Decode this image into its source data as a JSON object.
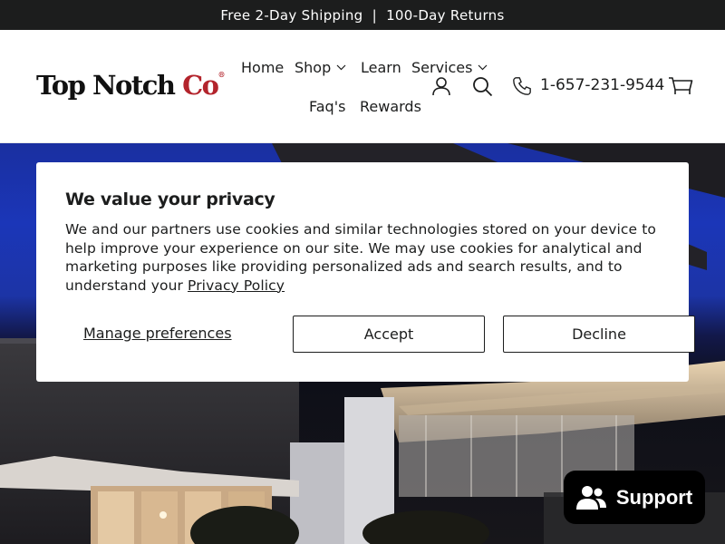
{
  "announcement": {
    "text": "Free 2-Day Shipping  |  100-Day Returns"
  },
  "header": {
    "logo": {
      "text": "Top Notch ",
      "accent": "Co",
      "reg": "®"
    },
    "nav": [
      {
        "label": "Home"
      },
      {
        "label": "Shop",
        "has_dropdown": true
      },
      {
        "label": "Learn"
      },
      {
        "label": "Services",
        "has_dropdown": true
      },
      {
        "label": "Faq's"
      },
      {
        "label": "Rewards"
      }
    ],
    "phone": "1-657-231-9544",
    "icons": [
      "account-icon",
      "search-icon",
      "phone-icon",
      "cart-icon"
    ]
  },
  "cookie_banner": {
    "title": "We value your privacy",
    "body": "We and our partners use cookies and similar technologies stored on your device to help improve your experience on our site. We may use cookies for analytical and marketing purposes like providing personalized ads and search results, and to understand your ",
    "privacy_link": "Privacy Policy",
    "manage_label": "Manage preferences",
    "accept_label": "Accept",
    "decline_label": "Decline"
  },
  "support_button": {
    "label": "Support",
    "icon": "people-icon"
  },
  "colors": {
    "topbar": "#1c1d1d",
    "brand_red": "#b3242c",
    "support_bg": "#000000",
    "hero_sky": "#1b36b8"
  }
}
